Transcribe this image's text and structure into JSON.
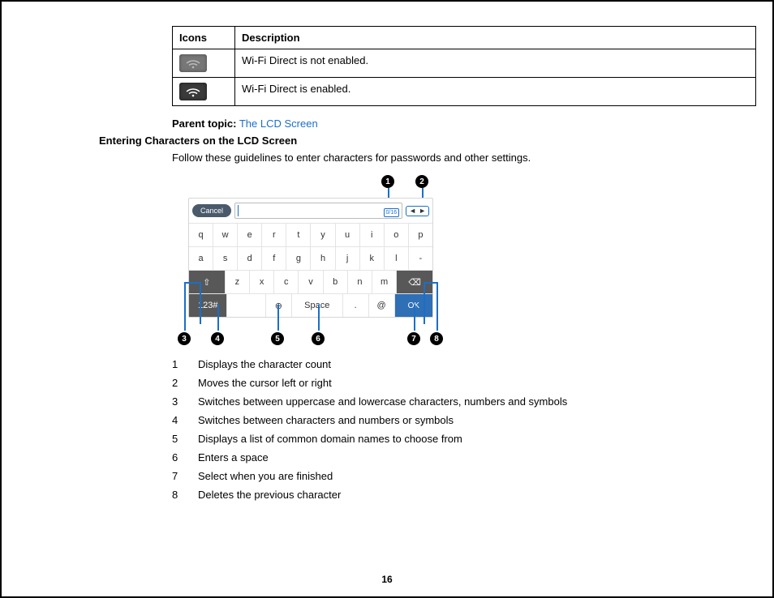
{
  "page_number": "16",
  "icon_table": {
    "headers": [
      "Icons",
      "Description"
    ],
    "rows": [
      {
        "desc": "Wi-Fi Direct is not enabled."
      },
      {
        "desc": "Wi-Fi Direct is enabled."
      }
    ]
  },
  "parent_topic": {
    "label": "Parent topic:",
    "link": "The LCD Screen"
  },
  "section_heading": "Entering Characters on the LCD Screen",
  "intro": "Follow these guidelines to enter characters for passwords and other settings.",
  "keyboard": {
    "cancel": "Cancel",
    "count": "0/16",
    "arrow_left": "◄",
    "arrow_right": "►",
    "row1": [
      "q",
      "w",
      "e",
      "r",
      "t",
      "y",
      "u",
      "i",
      "o",
      "p"
    ],
    "row2": [
      "a",
      "s",
      "d",
      "f",
      "g",
      "h",
      "j",
      "k",
      "l",
      "-"
    ],
    "row3_mid": [
      "z",
      "x",
      "c",
      "v",
      "b",
      "n",
      "m"
    ],
    "shift_glyph": "⇧",
    "backspace_glyph": "⌫",
    "mode_label": "123#",
    "domain_glyph": "⊕",
    "space_label": "Space",
    "period": ".",
    "at": "@",
    "ok_label": "OK",
    "callouts_top": [
      "1",
      "2"
    ],
    "callouts_bottom": [
      "3",
      "4",
      "5",
      "6",
      "7",
      "8"
    ]
  },
  "legend": [
    {
      "n": "1",
      "text": "Displays the character count"
    },
    {
      "n": "2",
      "text": "Moves the cursor left or right"
    },
    {
      "n": "3",
      "text": "Switches between uppercase and lowercase characters, numbers and symbols"
    },
    {
      "n": "4",
      "text": "Switches between characters and numbers or symbols"
    },
    {
      "n": "5",
      "text": "Displays a list of common domain names to choose from"
    },
    {
      "n": "6",
      "text": "Enters a space"
    },
    {
      "n": "7",
      "text": "Select when you are finished"
    },
    {
      "n": "8",
      "text": "Deletes the previous character"
    }
  ]
}
